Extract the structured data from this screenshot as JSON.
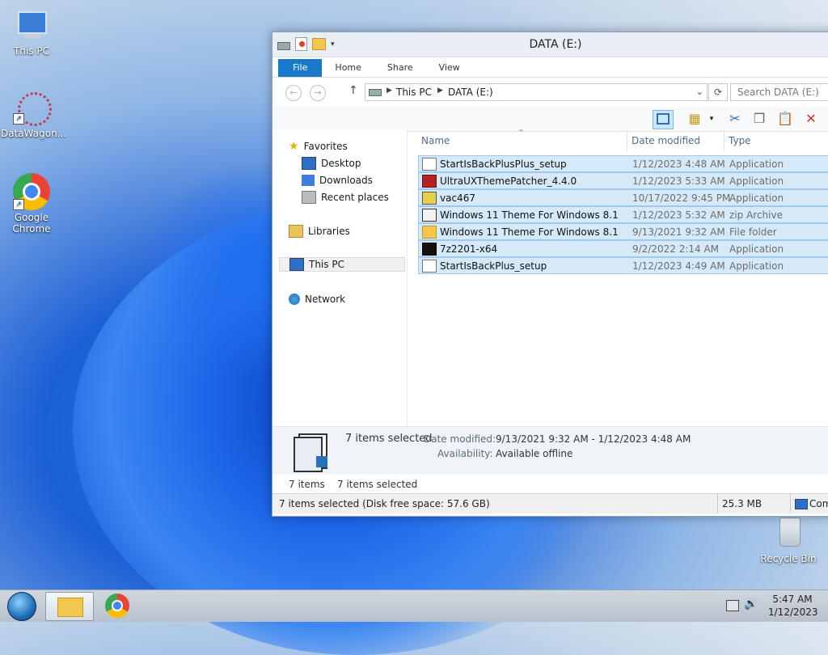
{
  "desktop": {
    "icons": [
      {
        "label": "This PC"
      },
      {
        "label": "DataWagon..."
      },
      {
        "label": "Google Chrome"
      },
      {
        "label": "Recycle Bin"
      }
    ]
  },
  "window": {
    "title": "DATA (E:)",
    "tabs": [
      "File",
      "Home",
      "Share",
      "View"
    ],
    "breadcrumb": [
      "This PC",
      "DATA (E:)"
    ],
    "search_placeholder": "Search DATA (E:)",
    "nav": {
      "favorites": "Favorites",
      "desktop": "Desktop",
      "downloads": "Downloads",
      "recent": "Recent places",
      "libraries": "Libraries",
      "thispc": "This PC",
      "network": "Network"
    },
    "columns": {
      "name": "Name",
      "date": "Date modified",
      "type": "Type"
    },
    "files": [
      {
        "name": "StartIsBackPlusPlus_setup",
        "date": "1/12/2023 4:48 AM",
        "type": "Application",
        "icon": "setup-icon"
      },
      {
        "name": "UltraUXThemePatcher_4.4.0",
        "date": "1/12/2023 5:33 AM",
        "type": "Application",
        "icon": "patcher-icon"
      },
      {
        "name": "vac467",
        "date": "10/17/2022 9:45 PM",
        "type": "Application",
        "icon": "app-icon"
      },
      {
        "name": "Windows 11 Theme For Windows 8.1",
        "date": "1/12/2023 5:32 AM",
        "type": "zip Archive",
        "icon": "zip-icon"
      },
      {
        "name": "Windows 11 Theme For Windows 8.1",
        "date": "9/13/2021 9:32 AM",
        "type": "File folder",
        "icon": "folder-icon"
      },
      {
        "name": "7z2201-x64",
        "date": "9/2/2022 2:14 AM",
        "type": "Application",
        "icon": "7zip-icon"
      },
      {
        "name": "StartIsBackPlus_setup",
        "date": "1/12/2023 4:49 AM",
        "type": "Application",
        "icon": "setup-icon"
      }
    ],
    "details": {
      "count": "7 items selected",
      "date_label": "Date modified:",
      "date_value": "9/13/2021 9:32 AM - 1/12/2023 4:48 AM",
      "avail_label": "Availability:",
      "avail_value": "Available offline"
    },
    "status": {
      "items": "7 items",
      "selected": "7 items selected",
      "bottom_left": "7 items selected (Disk free space: 57.6 GB)",
      "size": "25.3 MB",
      "computer": "Com"
    }
  },
  "taskbar": {
    "time": "5:47 AM",
    "date": "1/12/2023"
  }
}
